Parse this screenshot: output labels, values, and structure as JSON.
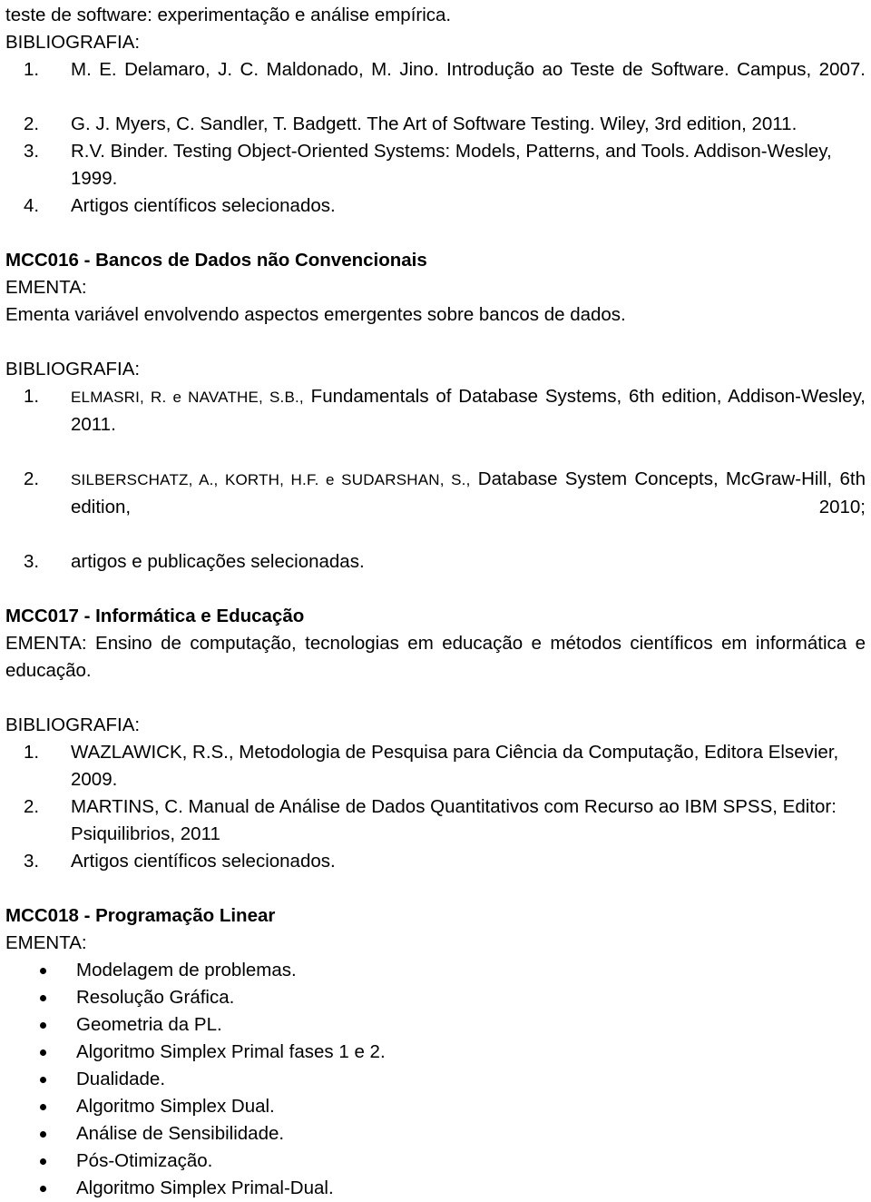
{
  "document": {
    "top_continuation": "teste de software: experimentação e análise empírica.",
    "labels": {
      "bibliografia": "BIBLIOGRAFIA:",
      "ementa": "EMENTA:"
    }
  },
  "intro_bibliography": {
    "label": "BIBLIOGRAFIA:",
    "items": [
      {
        "marker": "1.",
        "text": "M. E. Delamaro, J. C. Maldonado, M. Jino. Introdução ao Teste de Software. Campus, 2007."
      },
      {
        "marker": "2.",
        "text": "G. J. Myers, C. Sandler, T. Badgett. The Art of Software Testing. Wiley, 3rd edition, 2011."
      },
      {
        "marker": "3.",
        "text": "R.V. Binder. Testing Object-Oriented Systems: Models, Patterns, and Tools. Addison-Wesley, 1999."
      },
      {
        "marker": "4.",
        "text": "Artigos científicos selecionados."
      }
    ]
  },
  "mcc016": {
    "heading": "MCC016 - Bancos de Dados não Convencionais",
    "ementa_label": "EMENTA:",
    "ementa_text": "Ementa variável envolvendo aspectos emergentes sobre bancos de dados.",
    "bibliografia_label": "BIBLIOGRAFIA:",
    "items": [
      {
        "marker": "1.",
        "authors": "ELMASRI, R. e NAVATHE, S.B.,",
        "rest": " Fundamentals of Database Systems, 6th edition, Addison-Wesley, 2011."
      },
      {
        "marker": "2.",
        "authors": "SILBERSCHATZ, A., KORTH, H.F. e SUDARSHAN, S.,",
        "rest": " Database System Concepts, McGraw-Hill, 6th edition, 2010;"
      },
      {
        "marker": "3.",
        "authors": "",
        "rest": "artigos e publicações selecionadas."
      }
    ]
  },
  "mcc017": {
    "heading": "MCC017 - Informática e Educação",
    "ementa_text": "EMENTA: Ensino de computação, tecnologias em educação e métodos científicos em informática e educação.",
    "bibliografia_label": "BIBLIOGRAFIA:",
    "items": [
      {
        "marker": "1.",
        "text": "WAZLAWICK, R.S., Metodologia de Pesquisa para Ciência da Computação, Editora Elsevier, 2009."
      },
      {
        "marker": "2.",
        "text": "MARTINS, C. Manual de Análise de Dados Quantitativos com Recurso ao IBM SPSS, Editor: Psiquilibrios, 2011"
      },
      {
        "marker": "3.",
        "text": "Artigos científicos selecionados."
      }
    ]
  },
  "mcc018": {
    "heading": "MCC018 - Programação Linear",
    "ementa_label": "EMENTA:",
    "bullets": [
      "Modelagem de problemas.",
      "Resolução Gráfica.",
      "Geometria da PL.",
      "Algoritmo Simplex Primal fases 1 e 2.",
      "Dualidade.",
      "Algoritmo Simplex Dual.",
      "Análise de Sensibilidade.",
      "Pós-Otimização.",
      "Algoritmo Simplex Primal-Dual."
    ]
  }
}
